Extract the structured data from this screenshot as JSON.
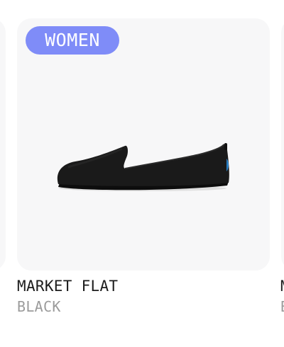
{
  "product": {
    "badge": "WOMEN",
    "name": "MARKET FLAT",
    "color": "BLACK",
    "image": "black-knit-flat-shoe"
  },
  "next_product_peek": {
    "name_initial": "M",
    "color_initial": "B"
  },
  "colors": {
    "badge_bg": "#7f8cf8",
    "card_bg": "#f7f7f8",
    "name_text": "#1c1c1c",
    "color_text": "#9b9b9b",
    "shoe_body": "#1a1a1a",
    "heel_accent": "#2a7fc4"
  }
}
